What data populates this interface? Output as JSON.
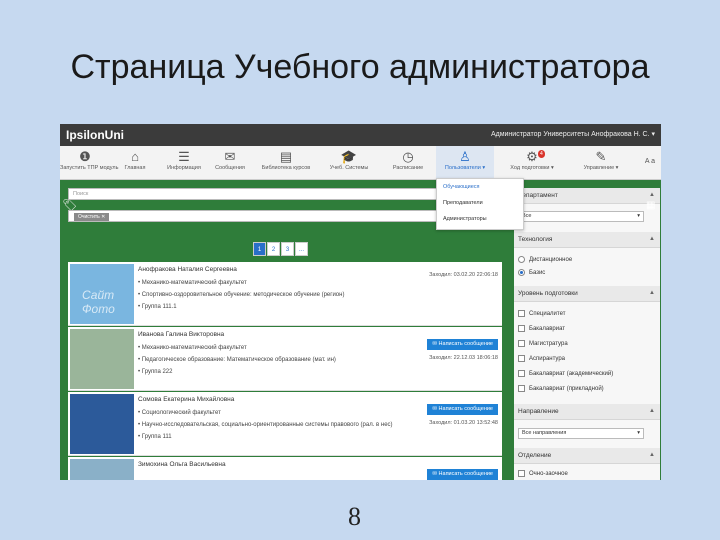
{
  "slide": {
    "title": "Страница Учебного администратора",
    "page_number": "8"
  },
  "app": {
    "brand": "IpsilonUni",
    "user": "Администратор Университеты Анофракова Н. С. ▾"
  },
  "nav": [
    {
      "label": "Запустить ТПР модуль",
      "icon": "info-icon",
      "glyph": "❶"
    },
    {
      "label": "Главная",
      "icon": "home-icon",
      "glyph": "⌂"
    },
    {
      "label": "Информация",
      "icon": "list-icon",
      "glyph": "☰"
    },
    {
      "label": "Сообщения",
      "icon": "mail-icon",
      "glyph": "✉"
    },
    {
      "label": "Библиотека курсов",
      "icon": "book-icon",
      "glyph": "▤"
    },
    {
      "label": "Учеб. Системы",
      "icon": "graduation-cap-icon",
      "glyph": "🎓"
    },
    {
      "label": "Расписание",
      "icon": "clock-icon",
      "glyph": "◷"
    },
    {
      "label": "Пользователи ▾",
      "icon": "users-icon",
      "glyph": "♙",
      "active": true
    },
    {
      "label": "Ход подготовки ▾",
      "icon": "gear-icon",
      "glyph": "⚙",
      "badge": "4"
    },
    {
      "label": "Управление ▾",
      "icon": "wrench-icon",
      "glyph": "✎"
    }
  ],
  "nav_extra": "A a",
  "dropdown": [
    "Обучающиеся",
    "Преподаватели",
    "Администраторы"
  ],
  "search": {
    "placeholder": "Поиск",
    "chip": "Очистить ✕"
  },
  "pager": [
    "1",
    "2",
    "3",
    "..."
  ],
  "people": [
    {
      "name": "Анофракова Наталия Сергеевна",
      "lines": [
        "Механико-математический факультет",
        "Спортивно-оздоровительное обучение: методическое обучение (регион)",
        "Группа 111.1"
      ],
      "time": "Заходил: 03.02.20 22:06:18",
      "thumb_label": "Сайт Фото",
      "thumb_color": "#7ab6e0",
      "has_button": false
    },
    {
      "name": "Иванова Галина Викторовна",
      "lines": [
        "Механико-математический факультет",
        "Педагогическое образование: Математическое образование (мат. ин)",
        "Группа 222"
      ],
      "time": "Заходил: 22.12.03 18:06:18",
      "thumb_label": "",
      "thumb_color": "#9ab59a",
      "has_button": true
    },
    {
      "name": "Сомова Екатерина Михайловна",
      "lines": [
        "Социологический факультет",
        "Научно-исследовательская, социально-ориентированные системы правового (рал. в нес)",
        "Группа 111"
      ],
      "time": "Заходил: 01.03.20 13:52:48",
      "thumb_label": "",
      "thumb_color": "#2c5a9a",
      "has_button": true
    },
    {
      "name": "Зимохина Ольга Васильевна",
      "lines": [],
      "time": "",
      "thumb_label": "",
      "thumb_color": "#8ab0c8",
      "has_button": true
    }
  ],
  "message_button": "✉ Написать сообщение",
  "sidebar": {
    "department": {
      "title": "Департамент",
      "select": "Все"
    },
    "category": {
      "title": "Технология",
      "options": [
        {
          "label": "Дистанционное",
          "checked": false
        },
        {
          "label": "Базис",
          "checked": true
        }
      ]
    },
    "level": {
      "title": "Уровень подготовки",
      "options": [
        "Специалитет",
        "Бакалавриат",
        "Магистратура",
        "Аспирантура",
        "Бакалавриат (академический)",
        "Бакалавриат (прикладной)"
      ]
    },
    "direction": {
      "title": "Направление",
      "select": "Все направления"
    },
    "branch": {
      "title": "Отделение",
      "options": [
        "Очно-заочное"
      ]
    }
  },
  "colors": {
    "accent": "#2a6fc9",
    "background_green": "#2f7d3a",
    "topbar": "#3b3b3b",
    "slide_bg": "#c6d9f0"
  }
}
